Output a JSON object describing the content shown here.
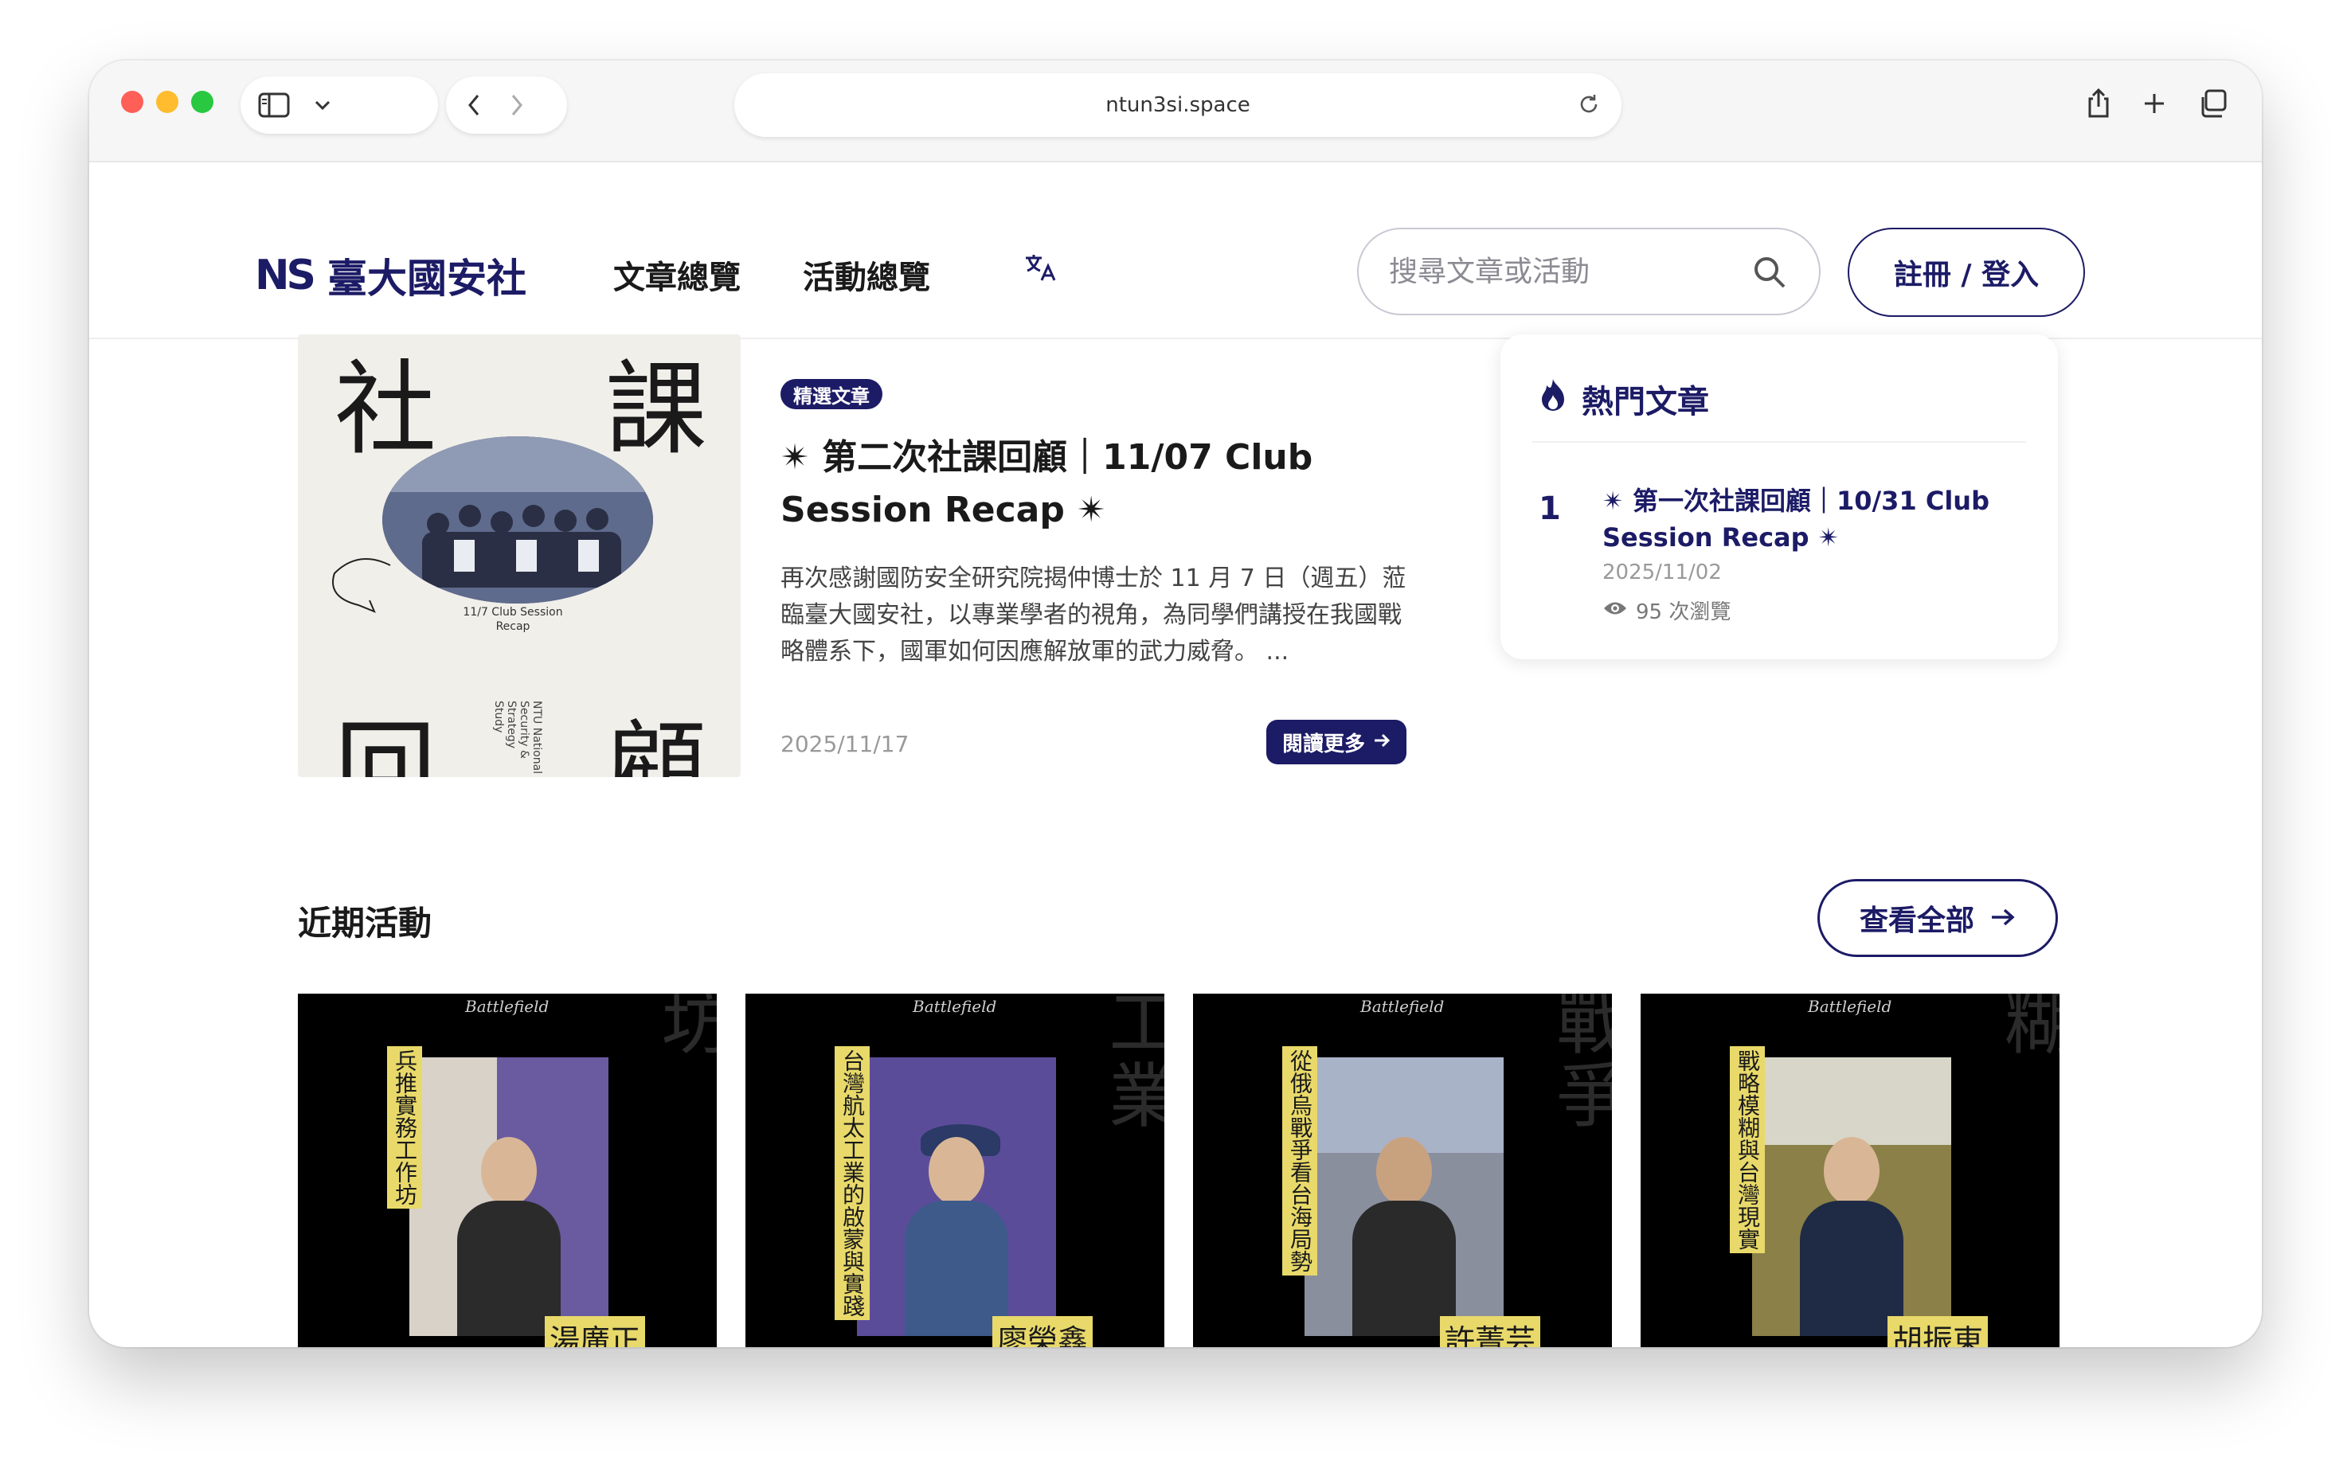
{
  "browser": {
    "url": "ntun3si.space",
    "icons": [
      "sidebar-icon",
      "chevron-down-icon",
      "back-icon",
      "forward-icon",
      "reload-icon",
      "share-icon",
      "new-tab-icon",
      "tabs-overview-icon"
    ]
  },
  "header": {
    "logo_text": "NS",
    "brand": "臺大國安社",
    "nav": [
      "文章總覽",
      "活動總覽"
    ],
    "search_placeholder": "搜尋文章或活動",
    "login": "註冊 / 登入"
  },
  "featured": {
    "image": {
      "char_tl": "社",
      "char_tr": "課",
      "char_bl": "回",
      "char_br": "顧",
      "caption": "11/7 Club Session Recap",
      "side_text": "NTU National Security & Strategy Study"
    },
    "tag": "精選文章",
    "title": "✴︎ 第二次社課回顧｜11/07 Club Session Recap ✴︎",
    "summary": "再次感謝國防安全研究院揭仲博士於 11 月 7 日（週五）蒞臨臺大國安社，以專業學者的視角，為同學們講授在我國戰略體系下，國軍如何因應解放軍的武力威脅。 ...",
    "date": "2025/11/17",
    "read_more": "閱讀更多"
  },
  "popular": {
    "heading": "熱門文章",
    "items": [
      {
        "rank": "1",
        "title": "✴︎ 第一次社課回顧｜10/31 Club Session Recap ✴︎",
        "date": "2025/11/02",
        "views": "95 次瀏覽"
      }
    ]
  },
  "events_section": {
    "title": "近期活動",
    "view_all": "查看全部",
    "events": [
      {
        "series": "Battlefield",
        "title": "兵推實務工作坊",
        "speaker": "湯廣正",
        "ghost": "推實務工作坊",
        "colors": {
          "panel": "#6a5aa0",
          "suit": "#2b2b2b"
        }
      },
      {
        "series": "Battlefield",
        "title": "台灣航太工業的啟蒙與實踐",
        "speaker": "廖榮鑫",
        "ghost": "啟蒙實務太工業",
        "colors": {
          "panel": "#5b4c9a",
          "suit": "#3d5a8a"
        }
      },
      {
        "series": "Battlefield",
        "title": "從俄烏戰爭看台海局勢",
        "speaker": "許菁芸",
        "ghost": "台海局勢烏戰爭",
        "colors": {
          "panel": "#8a8f9e",
          "suit": "#2a2a2a"
        }
      },
      {
        "series": "Battlefield",
        "title": "戰略模糊與台灣現實",
        "speaker": "胡振東",
        "ghost": "灣現實略模糊",
        "colors": {
          "panel": "#8a8048",
          "suit": "#1f2a44"
        }
      }
    ]
  },
  "colors": {
    "brand": "#1c1b66",
    "accent_yellow": "#e8d96a"
  }
}
